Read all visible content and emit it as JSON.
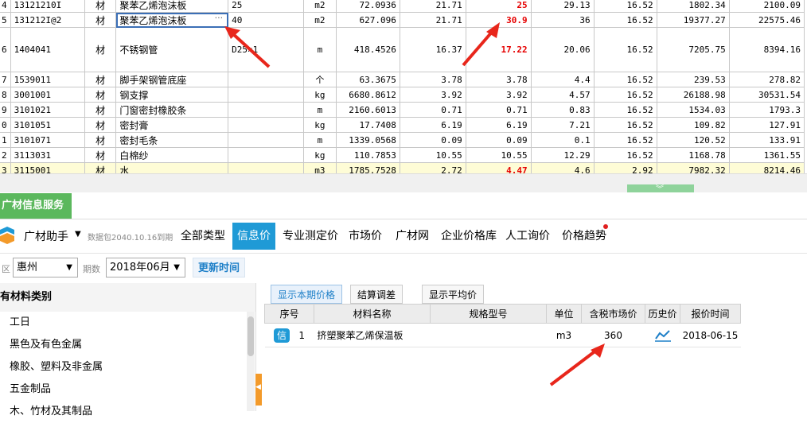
{
  "grid": {
    "rows": [
      {
        "seq": "4",
        "code": "13121210I",
        "type": "材",
        "name": "聚苯乙烯泡沫板",
        "spec": "25",
        "unit": "m2",
        "qty": "72.0936",
        "p1": "21.71",
        "p2": "25",
        "p3": "29.13",
        "p4": "16.52",
        "a1": "1802.34",
        "a2": "2100.09",
        "red": true
      },
      {
        "seq": "5",
        "code": "131212I@2",
        "type": "材",
        "name": "聚苯乙烯泡沫板",
        "spec": "40",
        "unit": "m2",
        "qty": "627.096",
        "p1": "21.71",
        "p2": "30.9",
        "p3": "36",
        "p4": "16.52",
        "a1": "19377.27",
        "a2": "22575.46",
        "red": true,
        "selected": true
      },
      {
        "seq": "6",
        "code": "1404041",
        "type": "材",
        "name": "不锈钢管",
        "spec": "D25×1",
        "unit": "m",
        "qty": "418.4526",
        "p1": "16.37",
        "p2": "17.22",
        "p3": "20.06",
        "p4": "16.52",
        "a1": "7205.75",
        "a2": "8394.16",
        "red": true,
        "tall": true
      },
      {
        "seq": "7",
        "code": "1539011",
        "type": "材",
        "name": "脚手架钢管底座",
        "spec": "",
        "unit": "个",
        "qty": "63.3675",
        "p1": "3.78",
        "p2": "3.78",
        "p3": "4.4",
        "p4": "16.52",
        "a1": "239.53",
        "a2": "278.82"
      },
      {
        "seq": "8",
        "code": "3001001",
        "type": "材",
        "name": "钢支撑",
        "spec": "",
        "unit": "kg",
        "qty": "6680.8612",
        "p1": "3.92",
        "p2": "3.92",
        "p3": "4.57",
        "p4": "16.52",
        "a1": "26188.98",
        "a2": "30531.54"
      },
      {
        "seq": "9",
        "code": "3101021",
        "type": "材",
        "name": "门窗密封橡胶条",
        "spec": "",
        "unit": "m",
        "qty": "2160.6013",
        "p1": "0.71",
        "p2": "0.71",
        "p3": "0.83",
        "p4": "16.52",
        "a1": "1534.03",
        "a2": "1793.3"
      },
      {
        "seq": "0",
        "code": "3101051",
        "type": "材",
        "name": "密封膏",
        "spec": "",
        "unit": "kg",
        "qty": "17.7408",
        "p1": "6.19",
        "p2": "6.19",
        "p3": "7.21",
        "p4": "16.52",
        "a1": "109.82",
        "a2": "127.91"
      },
      {
        "seq": "1",
        "code": "3101071",
        "type": "材",
        "name": "密封毛条",
        "spec": "",
        "unit": "m",
        "qty": "1339.0568",
        "p1": "0.09",
        "p2": "0.09",
        "p3": "0.1",
        "p4": "16.52",
        "a1": "120.52",
        "a2": "133.91"
      },
      {
        "seq": "2",
        "code": "3113031",
        "type": "材",
        "name": "白棉纱",
        "spec": "",
        "unit": "kg",
        "qty": "110.7853",
        "p1": "10.55",
        "p2": "10.55",
        "p3": "12.29",
        "p4": "16.52",
        "a1": "1168.78",
        "a2": "1361.55"
      },
      {
        "seq": "3",
        "code": "3115001",
        "type": "材",
        "name": "水",
        "spec": "",
        "unit": "m3",
        "qty": "1785.7528",
        "p1": "2.72",
        "p2": "4.47",
        "p3": "4.6",
        "p4": "2.92",
        "a1": "7982.32",
        "a2": "8214.46",
        "red": true,
        "yellow": true
      }
    ]
  },
  "service_tab": "广材信息服务",
  "nav": {
    "helper": "广材助手",
    "package": "数据包2040.10.16到期",
    "tabs": [
      "全部类型",
      "信息价",
      "专业测定价",
      "市场价",
      "广材网",
      "企业价格库",
      "人工询价",
      "价格趋势"
    ],
    "active_tab": "信息价"
  },
  "filter": {
    "region_label": "区",
    "region_value": "惠州",
    "period_label": "期数",
    "period_value": "2018年06月",
    "refresh_label": "更新时间"
  },
  "tree": {
    "header": "有材料类别",
    "items": [
      "工日",
      "黑色及有色金属",
      "橡胶、塑料及非金属",
      "五金制品",
      "木、竹材及其制品"
    ]
  },
  "price": {
    "subtabs": [
      "显示本期价格",
      "结算调差",
      "显示平均价"
    ],
    "columns": [
      "序号",
      "材料名称",
      "规格型号",
      "单位",
      "含税市场价",
      "历史价",
      "报价时间"
    ],
    "rows": [
      {
        "badge": "信",
        "seq": "1",
        "name": "挤塑聚苯乙烯保温板",
        "spec": "",
        "unit": "m3",
        "price": "360",
        "date": "2018-06-15"
      }
    ]
  },
  "colors": {
    "accent": "#1f9ad6",
    "green": "#5bb85d",
    "red": "#e60000",
    "arrow": "#e8261b"
  }
}
